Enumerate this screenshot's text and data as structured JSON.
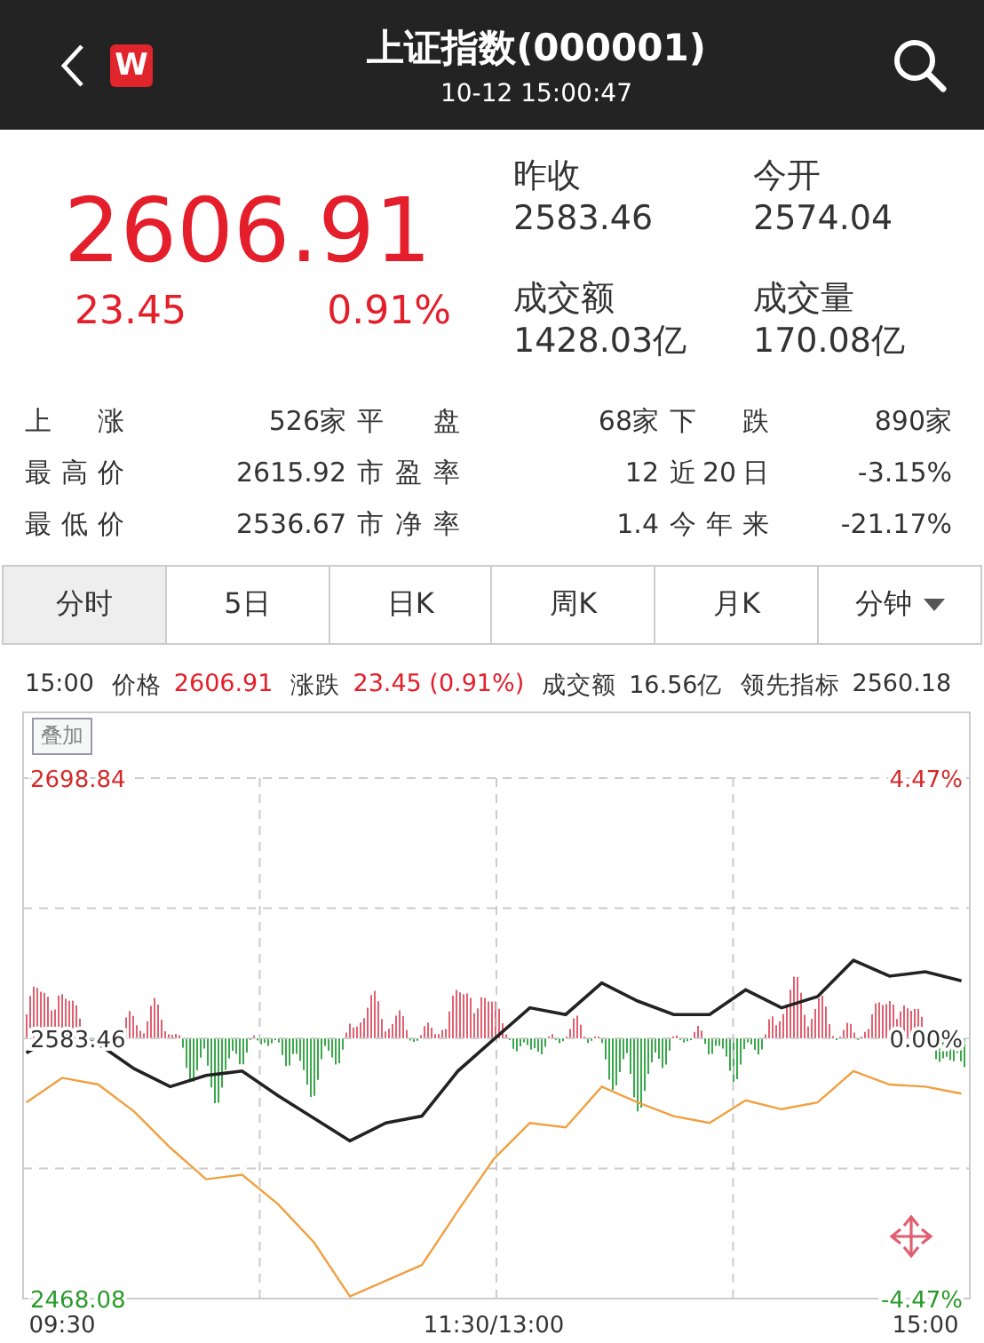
{
  "header": {
    "logo": "W",
    "title": "上证指数(000001)",
    "time": "10-12 15:00:47"
  },
  "quote": {
    "price": "2606.91",
    "change": "23.45",
    "change_pct": "0.91%",
    "fields": [
      {
        "label": "昨收",
        "value": "2583.46"
      },
      {
        "label": "今开",
        "value": "2574.04"
      },
      {
        "label": "成交额",
        "value": "1428.03亿"
      },
      {
        "label": "成交量",
        "value": "170.08亿"
      }
    ]
  },
  "stats": [
    [
      {
        "label": "上 涨",
        "value": "526家"
      },
      {
        "label": "平 盘",
        "value": "68家"
      },
      {
        "label": "下 跌",
        "value": "890家"
      }
    ],
    [
      {
        "label": "最高价",
        "value": "2615.92"
      },
      {
        "label": "市盈率",
        "value": "12"
      },
      {
        "label": "近20日",
        "value": "-3.15%"
      }
    ],
    [
      {
        "label": "最低价",
        "value": "2536.67"
      },
      {
        "label": "市净率",
        "value": "1.4"
      },
      {
        "label": "今年来",
        "value": "-21.17%"
      }
    ]
  ],
  "tabs": [
    {
      "label": "分时",
      "selected": true
    },
    {
      "label": "5日",
      "selected": false
    },
    {
      "label": "日K",
      "selected": false
    },
    {
      "label": "周K",
      "selected": false
    },
    {
      "label": "月K",
      "selected": false
    },
    {
      "label": "分钟",
      "selected": false,
      "dropdown": true
    }
  ],
  "info": {
    "time": "15:00",
    "items": [
      {
        "label": "价格",
        "value": "2606.91",
        "up": true
      },
      {
        "label": "涨跌",
        "value": "23.45 (0.91%)",
        "up": true
      },
      {
        "label": "成交额",
        "value": "16.56亿",
        "up": false
      },
      {
        "label": "领先指标",
        "value": "2560.18",
        "up": false
      }
    ]
  },
  "overlay_button": "叠加",
  "chart_data": {
    "type": "line",
    "categories": [
      null,
      "09:30",
      null,
      null,
      null,
      null,
      null,
      null,
      null,
      null,
      null,
      null,
      null,
      "11:30/13:00",
      null,
      null,
      null,
      null,
      null,
      null,
      null,
      null,
      null,
      null,
      null,
      "15:00",
      null
    ],
    "series": [
      {
        "color": "#222222",
        "values": [
          2577,
          2586,
          2581,
          2570,
          2562,
          2567,
          2569,
          2558,
          2548,
          2538,
          2546,
          2549,
          2569,
          2583,
          2597,
          2594,
          2608,
          2600,
          2594,
          2594,
          2605,
          2597,
          2602,
          2618,
          2611,
          2613,
          2609
        ]
      },
      {
        "color": "#f0a040",
        "values": [
          2555,
          2566,
          2563,
          2551,
          2535,
          2521,
          2523,
          2510,
          2493,
          2469,
          2476,
          2483,
          2507,
          2530,
          2546,
          2544,
          2562,
          2555,
          2549,
          2546,
          2556,
          2552,
          2555,
          2569,
          2563,
          2562,
          2559
        ]
      }
    ],
    "ylim": [
      2468.08,
      2698.84
    ],
    "yticks": [
      2698.84,
      2583.46,
      2468.08
    ],
    "grid": true
  },
  "right_axis_labels": [
    "4.47%",
    "0.00%",
    "-4.47%"
  ]
}
